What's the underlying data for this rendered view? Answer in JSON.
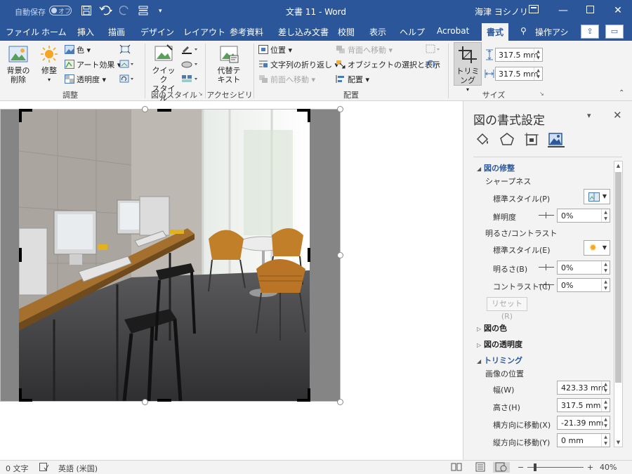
{
  "titlebar": {
    "autosave_label": "自動保存",
    "autosave_state": "オフ",
    "doc_title": "文書 11  -  Word",
    "user_name": "海津 ヨシノリ"
  },
  "tabs": [
    {
      "label": "ファイル"
    },
    {
      "label": "ホーム"
    },
    {
      "label": "挿入"
    },
    {
      "label": "描画"
    },
    {
      "label": "デザイン"
    },
    {
      "label": "レイアウト"
    },
    {
      "label": "参考資料"
    },
    {
      "label": "差し込み文書"
    },
    {
      "label": "校閲"
    },
    {
      "label": "表示"
    },
    {
      "label": "ヘルプ"
    },
    {
      "label": "Acrobat"
    },
    {
      "label": "書式"
    },
    {
      "label": "操作アシ"
    }
  ],
  "ribbon": {
    "remove_bg": [
      "背景の",
      "削除"
    ],
    "corrections": "修整",
    "color": "色",
    "art_effects": "アート効果",
    "transparency": "透明度",
    "group_adjust": "調整",
    "quick_styles": [
      "クイック",
      "スタイル"
    ],
    "group_styles": "図のスタイル",
    "alt_text": [
      "代替テ",
      "キスト"
    ],
    "group_access": "アクセシビリティ",
    "position": "位置",
    "wrap_text": "文字列の折り返し",
    "bring_forward": "前面へ移動",
    "send_backward": "背面へ移動",
    "selection_pane": "オブジェクトの選択と表示",
    "align": "配置",
    "group_arrange": "配置",
    "crop": "トリミング",
    "height_value": "317.5 mm",
    "width_value": "317.5 mm",
    "group_size": "サイズ"
  },
  "pane": {
    "title": "図の書式設定",
    "section_corrections": "図の修整",
    "sharpness_heading": "シャープネス",
    "preset_label": "標準スタイル(P)",
    "sharpness_label": "鮮明度",
    "sharpness_value": "0%",
    "bc_heading": "明るさ/コントラスト",
    "bc_preset_label": "標準スタイル(E)",
    "brightness_label": "明るさ(B)",
    "brightness_value": "0%",
    "contrast_label": "コントラスト(C)",
    "contrast_value": "0%",
    "reset_label": "リセット(R)",
    "section_color": "図の色",
    "section_transparency": "図の透明度",
    "section_crop": "トリミング",
    "image_position": "画像の位置",
    "width_label": "幅(W)",
    "width_value": "423.33 mm",
    "height_label": "高さ(H)",
    "height_value": "317.5 mm",
    "offset_x_label": "横方向に移動(X)",
    "offset_x_value": "-21.39 mm",
    "offset_y_label": "縦方向に移動(Y)",
    "offset_y_value": "0 mm"
  },
  "status": {
    "words": "0 文字",
    "language": "英語 (米国)",
    "zoom": "40%"
  },
  "colors": {
    "accent": "#2b579a",
    "ribbon_bg": "#f3f3f3"
  }
}
